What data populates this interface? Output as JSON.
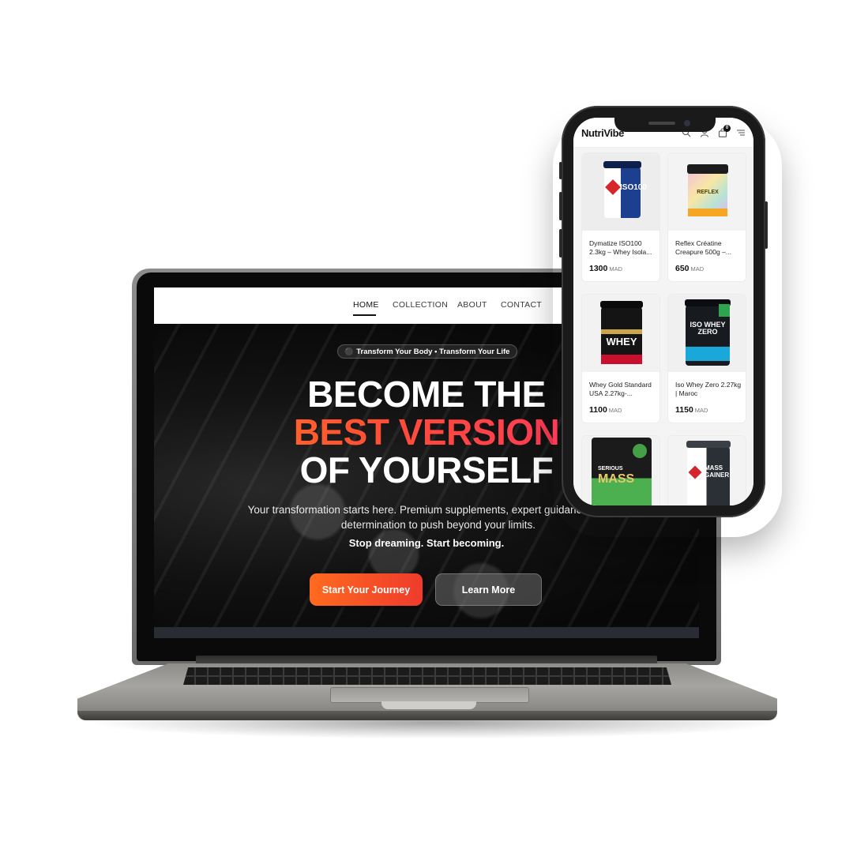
{
  "website": {
    "nav": [
      {
        "label": "HOME",
        "active": true
      },
      {
        "label": "COLLECTION",
        "active": false
      },
      {
        "label": "ABOUT",
        "active": false
      },
      {
        "label": "CONTACT",
        "active": false
      }
    ],
    "hero": {
      "badge": "Transform Your Body • Transform Your Life",
      "badge_icon": "trophy-icon",
      "headline_line1": "BECOME THE",
      "headline_line2": "BEST VERSION",
      "headline_line3": "OF YOURSELF",
      "subtitle": "Your transformation starts here. Premium supplements, expert guidance, and the determination to push beyond your limits.",
      "tagline": "Stop dreaming. Start becoming.",
      "primary_cta": "Start Your Journey",
      "secondary_cta": "Learn More"
    },
    "colors": {
      "accent_start": "#ff7a1a",
      "accent_end": "#ff2f6e",
      "primary_button": "#ef3b2d"
    }
  },
  "mobile": {
    "brand": "NutriVibe",
    "header_icons": [
      "search-icon",
      "user-icon",
      "cart-icon",
      "menu-icon"
    ],
    "cart_count": "0",
    "products": [
      {
        "name": "Dymatize ISO100 2.3kg – Whey Isola...",
        "price": "1300",
        "currency": "MAD",
        "image": "iso100-tub"
      },
      {
        "name": "Reflex Créatine Creapure 500g –...",
        "price": "650",
        "currency": "MAD",
        "image": "reflex-creatine-tub"
      },
      {
        "name": "Whey Gold Standard USA 2.27kg-...",
        "price": "1100",
        "currency": "MAD",
        "image": "gold-standard-whey-tub"
      },
      {
        "name": "Iso Whey Zero 2.27kg | Maroc",
        "price": "1150",
        "currency": "MAD",
        "image": "iso-whey-zero-tub"
      },
      {
        "name": "",
        "price": "",
        "currency": "",
        "image": "serious-mass-bag"
      },
      {
        "name": "",
        "price": "",
        "currency": "",
        "image": "super-mass-gainer-tub"
      }
    ],
    "product_labels": {
      "iso100": "ISO100",
      "reflex": "REFLEX",
      "whey": "WHEY",
      "iso_whey_zero": "ISO WHEY ZERO",
      "serious_mass_top": "SERIOUS",
      "serious_mass": "MASS",
      "mass_gainer": "MASS GAINER"
    }
  }
}
